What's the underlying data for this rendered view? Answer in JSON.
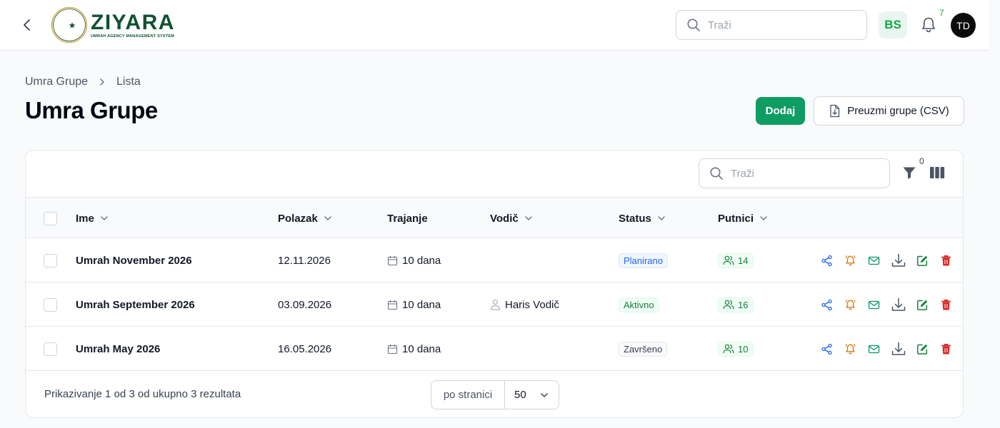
{
  "brand": {
    "name": "ZIYARA",
    "tagline": "UMRAH AGENCY MANAGEMENT SYSTEM",
    "color": "#0f5132",
    "accent": "#0f9d64"
  },
  "header": {
    "search_placeholder": "Traži",
    "language": "BS",
    "notifications_count": "7",
    "user_initials": "TD"
  },
  "breadcrumb": {
    "items": [
      "Umra Grupe",
      "Lista"
    ]
  },
  "page": {
    "title": "Umra Grupe",
    "add_label": "Dodaj",
    "export_label": "Preuzmi grupe (CSV)"
  },
  "table": {
    "search_placeholder": "Traži",
    "filter_count": "0",
    "columns": {
      "name": "Ime",
      "departure": "Polazak",
      "duration": "Trajanje",
      "guide": "Vodič",
      "status": "Status",
      "passengers": "Putnici"
    },
    "rows": [
      {
        "name": "Umrah November 2026",
        "departure": "12.11.2026",
        "duration": "10 dana",
        "guide": "",
        "status": "Planirano",
        "passengers": "14"
      },
      {
        "name": "Umrah September 2026",
        "departure": "03.09.2026",
        "duration": "10 dana",
        "guide": "Haris Vodič",
        "status": "Aktivno",
        "passengers": "16"
      },
      {
        "name": "Umrah May 2026",
        "departure": "16.05.2026",
        "duration": "10 dana",
        "guide": "",
        "status": "Završeno",
        "passengers": "10"
      }
    ],
    "footer": {
      "summary": "Prikazivanje 1 od 3 od ukupno 3 rezultata",
      "per_page_label": "po stranici",
      "per_page_value": "50"
    }
  },
  "icons": {
    "back": "chevron-left-icon",
    "search": "search-icon",
    "bell": "bell-icon",
    "filter": "funnel-icon",
    "columns": "columns-icon",
    "calendar": "calendar-icon",
    "user": "user-icon",
    "users": "users-icon",
    "share": "share-icon",
    "reminder": "bell-icon",
    "email": "mail-icon",
    "download": "download-icon",
    "edit": "edit-icon",
    "delete": "trash-icon"
  },
  "colors": {
    "share": "#2563eb",
    "reminder": "#d97706",
    "email": "#059669",
    "download": "#4b5563",
    "edit": "#15803d",
    "delete": "#dc2626"
  }
}
